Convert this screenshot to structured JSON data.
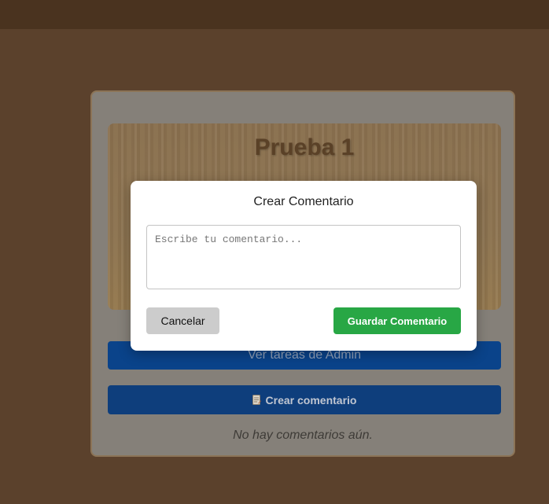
{
  "project": {
    "title": "Prueba 1"
  },
  "actions": {
    "admin_tasks_label": "Ver tareas de Admin",
    "create_comment_label": "Crear comentario",
    "create_comment_icon": "memo-icon"
  },
  "comments": {
    "empty_message": "No hay comentarios aún."
  },
  "modal": {
    "title": "Crear Comentario",
    "textarea_value": "",
    "textarea_placeholder": "Escribe tu comentario...",
    "cancel_label": "Cancelar",
    "save_label": "Guardar Comentario"
  },
  "colors": {
    "primary_blue": "#0d6efd",
    "success_green": "#28a745",
    "cancel_gray": "#cccccc",
    "background_brown": "#6b4a32"
  }
}
